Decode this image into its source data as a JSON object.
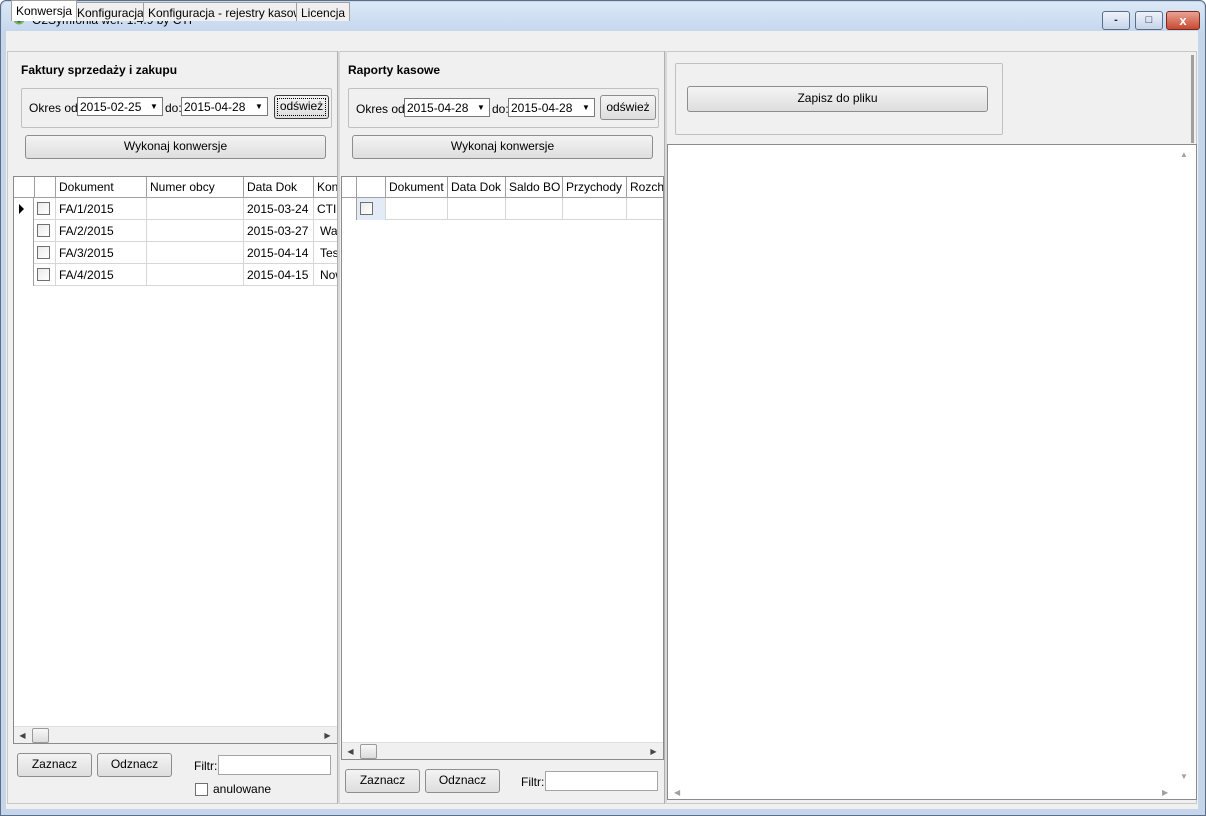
{
  "window": {
    "title": "O2Symfonia  wer. 1.4.9 by CTI",
    "controls": {
      "minimize": "-",
      "maximize": "□",
      "close": "x"
    }
  },
  "tabs": [
    {
      "label": "Konwersja",
      "active": true
    },
    {
      "label": "Konfiguracja",
      "active": false
    },
    {
      "label": "Konfiguracja - rejestry kasowe",
      "active": false
    },
    {
      "label": "Licencja",
      "active": false
    }
  ],
  "invoices": {
    "title": "Faktury sprzedaży i zakupu",
    "from_label": "Okres od:",
    "from_value": "2015-02-25",
    "to_label": "do:",
    "to_value": "2015-04-28",
    "refresh_label": "odśwież",
    "convert_label": "Wykonaj konwersje",
    "columns": [
      "Dokument",
      "Numer obcy",
      "Data Dok",
      "Kont"
    ],
    "rows": [
      {
        "dokument": "FA/1/2015",
        "numer_obcy": "",
        "data_dok": "2015-03-24",
        "kontrahent": "CTI",
        "current": true
      },
      {
        "dokument": "FA/2/2015",
        "numer_obcy": "",
        "data_dok": "2015-03-27",
        "kontrahent": "Wa",
        "current": false
      },
      {
        "dokument": "FA/3/2015",
        "numer_obcy": "",
        "data_dok": "2015-04-14",
        "kontrahent": "Tes",
        "current": false
      },
      {
        "dokument": "FA/4/2015",
        "numer_obcy": "",
        "data_dok": "2015-04-15",
        "kontrahent": "Now",
        "current": false
      }
    ],
    "select_label": "Zaznacz",
    "deselect_label": "Odznacz",
    "filter_label": "Filtr:",
    "filter_value": "",
    "cancelled_label": "anulowane"
  },
  "cash_reports": {
    "title": "Raporty kasowe",
    "from_label": "Okres od:",
    "from_value": "2015-04-28",
    "to_label": "do:",
    "to_value": "2015-04-28",
    "refresh_label": "odśwież",
    "convert_label": "Wykonaj konwersje",
    "columns": [
      "Dokument",
      "Data Dok",
      "Saldo BO",
      "Przychody",
      "Rozcho"
    ],
    "select_label": "Zaznacz",
    "deselect_label": "Odznacz",
    "filter_label": "Filtr:",
    "filter_value": ""
  },
  "output": {
    "save_label": "Zapisz do pliku",
    "content": ""
  },
  "icons": {
    "app": "app-icon",
    "row_pointer": "row-pointer-icon",
    "scroll_left": "scroll-left-arrow-icon",
    "scroll_right": "scroll-right-arrow-icon",
    "dropdown": "chevron-down-icon"
  }
}
